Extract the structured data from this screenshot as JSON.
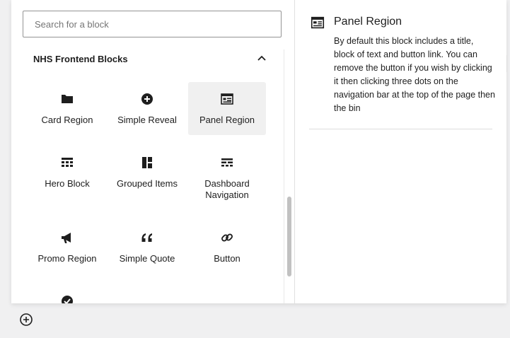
{
  "search": {
    "placeholder": "Search for a block"
  },
  "group": {
    "title": "NHS Frontend Blocks"
  },
  "blocks": [
    {
      "label": "Card Region",
      "icon": "folder-icon"
    },
    {
      "label": "Simple Reveal",
      "icon": "plus-circle-icon"
    },
    {
      "label": "Panel Region",
      "icon": "panel-icon",
      "selected": true
    },
    {
      "label": "Hero Block",
      "icon": "grid-icon"
    },
    {
      "label": "Grouped Items",
      "icon": "columns-icon"
    },
    {
      "label": "Dashboard Navigation",
      "icon": "table-icon"
    },
    {
      "label": "Promo Region",
      "icon": "megaphone-icon"
    },
    {
      "label": "Simple Quote",
      "icon": "quote-icon"
    },
    {
      "label": "Button",
      "icon": "link-icon"
    },
    {
      "label": "",
      "icon": "check-circle-icon"
    }
  ],
  "preview": {
    "title": "Panel Region",
    "description": "By default this block includes a title, block of text and button link. You can remove the button if you wish by clicking it then clicking three dots on the navigation bar at the top of the page then the bin"
  },
  "colors": {
    "text": "#1e1e1e",
    "selected_bg": "#f0f0f0",
    "border": "#949494",
    "backdrop": "#f0f0f1"
  }
}
